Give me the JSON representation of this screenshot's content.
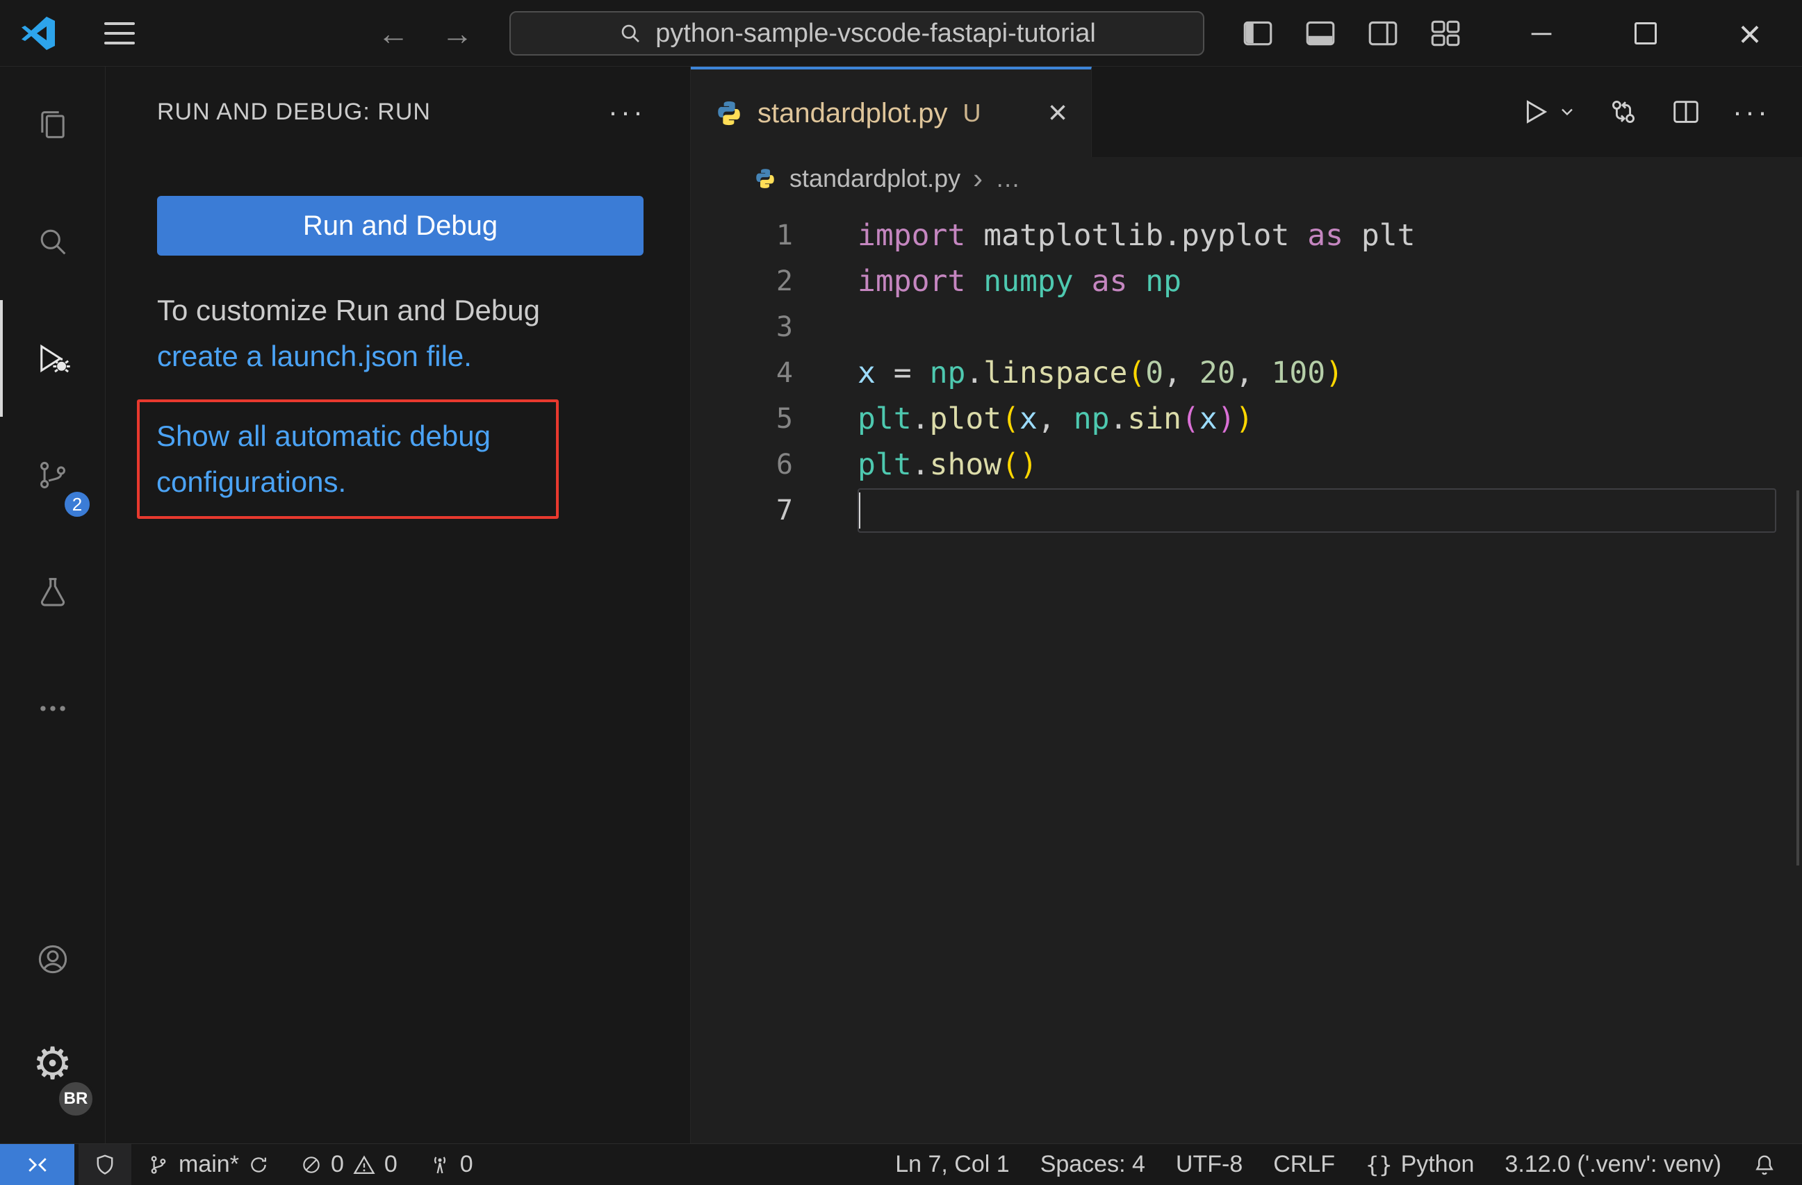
{
  "title_bar": {
    "search_text": "python-sample-vscode-fastapi-tutorial"
  },
  "icons": {
    "back": "←",
    "forward": "→",
    "minimize": "─",
    "close": "×",
    "tab_close": "×",
    "ellipsis_h": "···",
    "breadcrumb_chevron": "›",
    "gear": "⚙"
  },
  "activity_bar": {
    "scm_badge": "2",
    "profile_badge": "BR"
  },
  "sidebar": {
    "header_title": "RUN AND DEBUG: RUN",
    "run_button_label": "Run and Debug",
    "customize_text": "To customize Run and Debug",
    "launch_link_text": "create a launch.json file.",
    "auto_config_link_text": "Show all automatic debug configurations."
  },
  "editor": {
    "tab_label": "standardplot.py",
    "tab_git_badge": "U",
    "breadcrumb_file": "standardplot.py",
    "breadcrumb_more": "…",
    "code_lines": [
      {
        "num": "1",
        "tokens": [
          [
            "import",
            "kw"
          ],
          [
            " matplotlib.pyplot ",
            "plain"
          ],
          [
            "as",
            "kw"
          ],
          [
            " plt",
            "plain"
          ]
        ]
      },
      {
        "num": "2",
        "tokens": [
          [
            "import",
            "kw"
          ],
          [
            " ",
            "plain"
          ],
          [
            "numpy",
            "mod"
          ],
          [
            " ",
            "plain"
          ],
          [
            "as",
            "kw"
          ],
          [
            " ",
            "plain"
          ],
          [
            "np",
            "mod"
          ]
        ]
      },
      {
        "num": "3",
        "tokens": []
      },
      {
        "num": "4",
        "tokens": [
          [
            "x",
            "var"
          ],
          [
            " = ",
            "plain"
          ],
          [
            "np",
            "mod"
          ],
          [
            ".",
            "plain"
          ],
          [
            "linspace",
            "func"
          ],
          [
            "(",
            "b1"
          ],
          [
            "0",
            "num"
          ],
          [
            ", ",
            "plain"
          ],
          [
            "20",
            "num"
          ],
          [
            ", ",
            "plain"
          ],
          [
            "100",
            "num"
          ],
          [
            ")",
            "b1"
          ]
        ]
      },
      {
        "num": "5",
        "tokens": [
          [
            "plt",
            "mod"
          ],
          [
            ".",
            "plain"
          ],
          [
            "plot",
            "func"
          ],
          [
            "(",
            "b1"
          ],
          [
            "x",
            "var"
          ],
          [
            ", ",
            "plain"
          ],
          [
            "np",
            "mod"
          ],
          [
            ".",
            "plain"
          ],
          [
            "sin",
            "func"
          ],
          [
            "(",
            "b2"
          ],
          [
            "x",
            "var"
          ],
          [
            ")",
            "b2"
          ],
          [
            ")",
            "b1"
          ]
        ]
      },
      {
        "num": "6",
        "tokens": [
          [
            "plt",
            "mod"
          ],
          [
            ".",
            "plain"
          ],
          [
            "show",
            "func"
          ],
          [
            "(",
            "b1"
          ],
          [
            ")",
            "b1"
          ]
        ]
      },
      {
        "num": "7",
        "tokens": [],
        "active": true
      }
    ]
  },
  "status_bar": {
    "branch_label": "main*",
    "error_count": "0",
    "warning_count": "0",
    "port_count": "0",
    "cursor_position": "Ln 7, Col 1",
    "indentation": "Spaces: 4",
    "encoding": "UTF-8",
    "eol": "CRLF",
    "language_braces": "{}",
    "language": "Python",
    "interpreter": "3.12.0 ('.venv': venv)"
  },
  "colors": {
    "accent_blue": "#3b7cd6",
    "link_blue": "#4ba3f5",
    "annotation_red": "#e8392e",
    "panel_bg": "#181818",
    "editor_bg": "#1f1f1f",
    "untracked_file": "#dfc59a",
    "keyword": "#c586c0",
    "module": "#4ec9b0",
    "variable": "#9cdcfe",
    "function": "#dcdcaa",
    "number": "#b5cea8",
    "bracket_level1": "#ffd700",
    "bracket_level2": "#da70d6"
  }
}
